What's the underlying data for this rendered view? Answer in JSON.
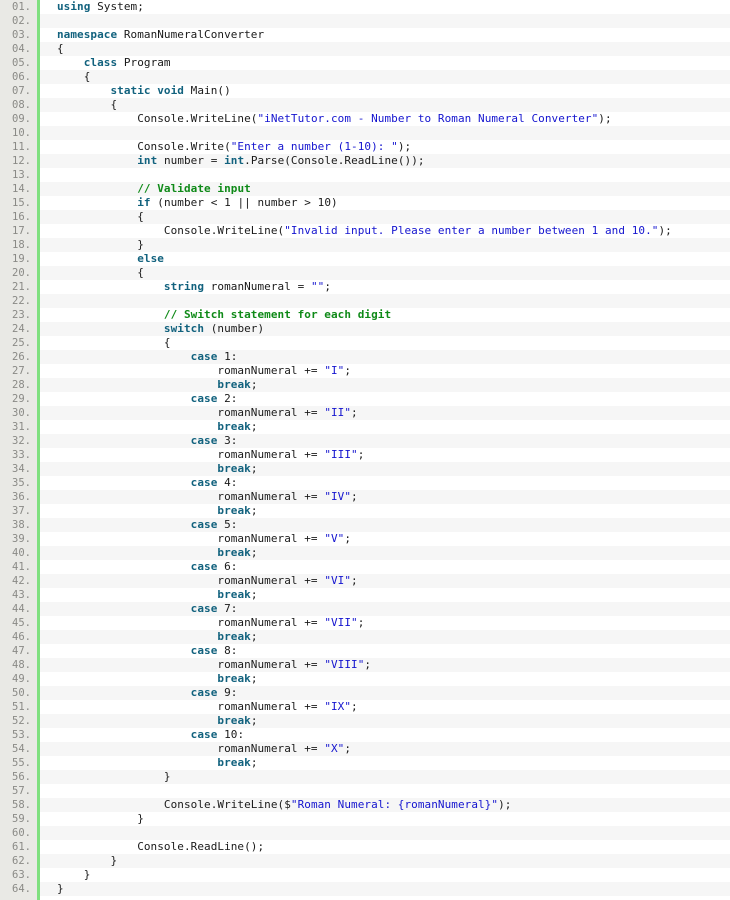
{
  "viewer": {
    "name": "code-listing",
    "language": "csharp",
    "total_lines": 64,
    "indent_unit_spaces": 4,
    "colors": {
      "background": "#ffffff",
      "alt_row": "#f6f6f6",
      "gutter_background": "#e9e9e5",
      "gutter_rule": "#7fe07f",
      "line_number": "#8a8a86",
      "plain": "#1a1a1a",
      "keyword": "#12627e",
      "string": "#1414cf",
      "comment": "#0f8a18"
    }
  },
  "lines": [
    {
      "n": "01.",
      "tokens": [
        {
          "t": "kw",
          "v": "using"
        },
        {
          "t": "pln",
          "v": " System;"
        }
      ]
    },
    {
      "n": "02.",
      "tokens": []
    },
    {
      "n": "03.",
      "tokens": [
        {
          "t": "kw",
          "v": "namespace"
        },
        {
          "t": "pln",
          "v": " RomanNumeralConverter"
        }
      ]
    },
    {
      "n": "04.",
      "tokens": [
        {
          "t": "pln",
          "v": "{"
        }
      ]
    },
    {
      "n": "05.",
      "tokens": [
        {
          "t": "pln",
          "v": "    "
        },
        {
          "t": "kw",
          "v": "class"
        },
        {
          "t": "pln",
          "v": " Program"
        }
      ]
    },
    {
      "n": "06.",
      "tokens": [
        {
          "t": "pln",
          "v": "    {"
        }
      ]
    },
    {
      "n": "07.",
      "tokens": [
        {
          "t": "pln",
          "v": "        "
        },
        {
          "t": "kw",
          "v": "static void"
        },
        {
          "t": "pln",
          "v": " Main()"
        }
      ]
    },
    {
      "n": "08.",
      "tokens": [
        {
          "t": "pln",
          "v": "        {"
        }
      ]
    },
    {
      "n": "09.",
      "tokens": [
        {
          "t": "pln",
          "v": "            Console.WriteLine("
        },
        {
          "t": "str",
          "v": "\"iNetTutor.com - Number to Roman Numeral Converter\""
        },
        {
          "t": "pln",
          "v": ");"
        }
      ]
    },
    {
      "n": "10.",
      "tokens": []
    },
    {
      "n": "11.",
      "tokens": [
        {
          "t": "pln",
          "v": "            Console.Write("
        },
        {
          "t": "str",
          "v": "\"Enter a number (1-10): \""
        },
        {
          "t": "pln",
          "v": ");"
        }
      ]
    },
    {
      "n": "12.",
      "tokens": [
        {
          "t": "pln",
          "v": "            "
        },
        {
          "t": "kw",
          "v": "int"
        },
        {
          "t": "pln",
          "v": " number = "
        },
        {
          "t": "kw",
          "v": "int"
        },
        {
          "t": "pln",
          "v": ".Parse(Console.ReadLine());"
        }
      ]
    },
    {
      "n": "13.",
      "tokens": []
    },
    {
      "n": "14.",
      "tokens": [
        {
          "t": "pln",
          "v": "            "
        },
        {
          "t": "com",
          "v": "// Validate input"
        }
      ]
    },
    {
      "n": "15.",
      "tokens": [
        {
          "t": "pln",
          "v": "            "
        },
        {
          "t": "kw",
          "v": "if"
        },
        {
          "t": "pln",
          "v": " (number < 1 || number > 10)"
        }
      ]
    },
    {
      "n": "16.",
      "tokens": [
        {
          "t": "pln",
          "v": "            {"
        }
      ]
    },
    {
      "n": "17.",
      "tokens": [
        {
          "t": "pln",
          "v": "                Console.WriteLine("
        },
        {
          "t": "str",
          "v": "\"Invalid input. Please enter a number between 1 and 10.\""
        },
        {
          "t": "pln",
          "v": ");"
        }
      ]
    },
    {
      "n": "18.",
      "tokens": [
        {
          "t": "pln",
          "v": "            }"
        }
      ]
    },
    {
      "n": "19.",
      "tokens": [
        {
          "t": "pln",
          "v": "            "
        },
        {
          "t": "kw",
          "v": "else"
        }
      ]
    },
    {
      "n": "20.",
      "tokens": [
        {
          "t": "pln",
          "v": "            {"
        }
      ]
    },
    {
      "n": "21.",
      "tokens": [
        {
          "t": "pln",
          "v": "                "
        },
        {
          "t": "kw",
          "v": "string"
        },
        {
          "t": "pln",
          "v": " romanNumeral = "
        },
        {
          "t": "str",
          "v": "\"\""
        },
        {
          "t": "pln",
          "v": ";"
        }
      ]
    },
    {
      "n": "22.",
      "tokens": []
    },
    {
      "n": "23.",
      "tokens": [
        {
          "t": "pln",
          "v": "                "
        },
        {
          "t": "com",
          "v": "// Switch statement for each digit"
        }
      ]
    },
    {
      "n": "24.",
      "tokens": [
        {
          "t": "pln",
          "v": "                "
        },
        {
          "t": "kw",
          "v": "switch"
        },
        {
          "t": "pln",
          "v": " (number)"
        }
      ]
    },
    {
      "n": "25.",
      "tokens": [
        {
          "t": "pln",
          "v": "                {"
        }
      ]
    },
    {
      "n": "26.",
      "tokens": [
        {
          "t": "pln",
          "v": "                    "
        },
        {
          "t": "kw",
          "v": "case"
        },
        {
          "t": "pln",
          "v": " 1:"
        }
      ]
    },
    {
      "n": "27.",
      "tokens": [
        {
          "t": "pln",
          "v": "                        romanNumeral += "
        },
        {
          "t": "str",
          "v": "\"I\""
        },
        {
          "t": "pln",
          "v": ";"
        }
      ]
    },
    {
      "n": "28.",
      "tokens": [
        {
          "t": "pln",
          "v": "                        "
        },
        {
          "t": "kw",
          "v": "break"
        },
        {
          "t": "pln",
          "v": ";"
        }
      ]
    },
    {
      "n": "29.",
      "tokens": [
        {
          "t": "pln",
          "v": "                    "
        },
        {
          "t": "kw",
          "v": "case"
        },
        {
          "t": "pln",
          "v": " 2:"
        }
      ]
    },
    {
      "n": "30.",
      "tokens": [
        {
          "t": "pln",
          "v": "                        romanNumeral += "
        },
        {
          "t": "str",
          "v": "\"II\""
        },
        {
          "t": "pln",
          "v": ";"
        }
      ]
    },
    {
      "n": "31.",
      "tokens": [
        {
          "t": "pln",
          "v": "                        "
        },
        {
          "t": "kw",
          "v": "break"
        },
        {
          "t": "pln",
          "v": ";"
        }
      ]
    },
    {
      "n": "32.",
      "tokens": [
        {
          "t": "pln",
          "v": "                    "
        },
        {
          "t": "kw",
          "v": "case"
        },
        {
          "t": "pln",
          "v": " 3:"
        }
      ]
    },
    {
      "n": "33.",
      "tokens": [
        {
          "t": "pln",
          "v": "                        romanNumeral += "
        },
        {
          "t": "str",
          "v": "\"III\""
        },
        {
          "t": "pln",
          "v": ";"
        }
      ]
    },
    {
      "n": "34.",
      "tokens": [
        {
          "t": "pln",
          "v": "                        "
        },
        {
          "t": "kw",
          "v": "break"
        },
        {
          "t": "pln",
          "v": ";"
        }
      ]
    },
    {
      "n": "35.",
      "tokens": [
        {
          "t": "pln",
          "v": "                    "
        },
        {
          "t": "kw",
          "v": "case"
        },
        {
          "t": "pln",
          "v": " 4:"
        }
      ]
    },
    {
      "n": "36.",
      "tokens": [
        {
          "t": "pln",
          "v": "                        romanNumeral += "
        },
        {
          "t": "str",
          "v": "\"IV\""
        },
        {
          "t": "pln",
          "v": ";"
        }
      ]
    },
    {
      "n": "37.",
      "tokens": [
        {
          "t": "pln",
          "v": "                        "
        },
        {
          "t": "kw",
          "v": "break"
        },
        {
          "t": "pln",
          "v": ";"
        }
      ]
    },
    {
      "n": "38.",
      "tokens": [
        {
          "t": "pln",
          "v": "                    "
        },
        {
          "t": "kw",
          "v": "case"
        },
        {
          "t": "pln",
          "v": " 5:"
        }
      ]
    },
    {
      "n": "39.",
      "tokens": [
        {
          "t": "pln",
          "v": "                        romanNumeral += "
        },
        {
          "t": "str",
          "v": "\"V\""
        },
        {
          "t": "pln",
          "v": ";"
        }
      ]
    },
    {
      "n": "40.",
      "tokens": [
        {
          "t": "pln",
          "v": "                        "
        },
        {
          "t": "kw",
          "v": "break"
        },
        {
          "t": "pln",
          "v": ";"
        }
      ]
    },
    {
      "n": "41.",
      "tokens": [
        {
          "t": "pln",
          "v": "                    "
        },
        {
          "t": "kw",
          "v": "case"
        },
        {
          "t": "pln",
          "v": " 6:"
        }
      ]
    },
    {
      "n": "42.",
      "tokens": [
        {
          "t": "pln",
          "v": "                        romanNumeral += "
        },
        {
          "t": "str",
          "v": "\"VI\""
        },
        {
          "t": "pln",
          "v": ";"
        }
      ]
    },
    {
      "n": "43.",
      "tokens": [
        {
          "t": "pln",
          "v": "                        "
        },
        {
          "t": "kw",
          "v": "break"
        },
        {
          "t": "pln",
          "v": ";"
        }
      ]
    },
    {
      "n": "44.",
      "tokens": [
        {
          "t": "pln",
          "v": "                    "
        },
        {
          "t": "kw",
          "v": "case"
        },
        {
          "t": "pln",
          "v": " 7:"
        }
      ]
    },
    {
      "n": "45.",
      "tokens": [
        {
          "t": "pln",
          "v": "                        romanNumeral += "
        },
        {
          "t": "str",
          "v": "\"VII\""
        },
        {
          "t": "pln",
          "v": ";"
        }
      ]
    },
    {
      "n": "46.",
      "tokens": [
        {
          "t": "pln",
          "v": "                        "
        },
        {
          "t": "kw",
          "v": "break"
        },
        {
          "t": "pln",
          "v": ";"
        }
      ]
    },
    {
      "n": "47.",
      "tokens": [
        {
          "t": "pln",
          "v": "                    "
        },
        {
          "t": "kw",
          "v": "case"
        },
        {
          "t": "pln",
          "v": " 8:"
        }
      ]
    },
    {
      "n": "48.",
      "tokens": [
        {
          "t": "pln",
          "v": "                        romanNumeral += "
        },
        {
          "t": "str",
          "v": "\"VIII\""
        },
        {
          "t": "pln",
          "v": ";"
        }
      ]
    },
    {
      "n": "49.",
      "tokens": [
        {
          "t": "pln",
          "v": "                        "
        },
        {
          "t": "kw",
          "v": "break"
        },
        {
          "t": "pln",
          "v": ";"
        }
      ]
    },
    {
      "n": "50.",
      "tokens": [
        {
          "t": "pln",
          "v": "                    "
        },
        {
          "t": "kw",
          "v": "case"
        },
        {
          "t": "pln",
          "v": " 9:"
        }
      ]
    },
    {
      "n": "51.",
      "tokens": [
        {
          "t": "pln",
          "v": "                        romanNumeral += "
        },
        {
          "t": "str",
          "v": "\"IX\""
        },
        {
          "t": "pln",
          "v": ";"
        }
      ]
    },
    {
      "n": "52.",
      "tokens": [
        {
          "t": "pln",
          "v": "                        "
        },
        {
          "t": "kw",
          "v": "break"
        },
        {
          "t": "pln",
          "v": ";"
        }
      ]
    },
    {
      "n": "53.",
      "tokens": [
        {
          "t": "pln",
          "v": "                    "
        },
        {
          "t": "kw",
          "v": "case"
        },
        {
          "t": "pln",
          "v": " 10:"
        }
      ]
    },
    {
      "n": "54.",
      "tokens": [
        {
          "t": "pln",
          "v": "                        romanNumeral += "
        },
        {
          "t": "str",
          "v": "\"X\""
        },
        {
          "t": "pln",
          "v": ";"
        }
      ]
    },
    {
      "n": "55.",
      "tokens": [
        {
          "t": "pln",
          "v": "                        "
        },
        {
          "t": "kw",
          "v": "break"
        },
        {
          "t": "pln",
          "v": ";"
        }
      ]
    },
    {
      "n": "56.",
      "tokens": [
        {
          "t": "pln",
          "v": "                }"
        }
      ]
    },
    {
      "n": "57.",
      "tokens": []
    },
    {
      "n": "58.",
      "tokens": [
        {
          "t": "pln",
          "v": "                Console.WriteLine($"
        },
        {
          "t": "str",
          "v": "\"Roman Numeral: {romanNumeral}\""
        },
        {
          "t": "pln",
          "v": ");"
        }
      ]
    },
    {
      "n": "59.",
      "tokens": [
        {
          "t": "pln",
          "v": "            }"
        }
      ]
    },
    {
      "n": "60.",
      "tokens": []
    },
    {
      "n": "61.",
      "tokens": [
        {
          "t": "pln",
          "v": "            Console.ReadLine();"
        }
      ]
    },
    {
      "n": "62.",
      "tokens": [
        {
          "t": "pln",
          "v": "        }"
        }
      ]
    },
    {
      "n": "63.",
      "tokens": [
        {
          "t": "pln",
          "v": "    }"
        }
      ]
    },
    {
      "n": "64.",
      "tokens": [
        {
          "t": "pln",
          "v": "}"
        }
      ]
    }
  ]
}
